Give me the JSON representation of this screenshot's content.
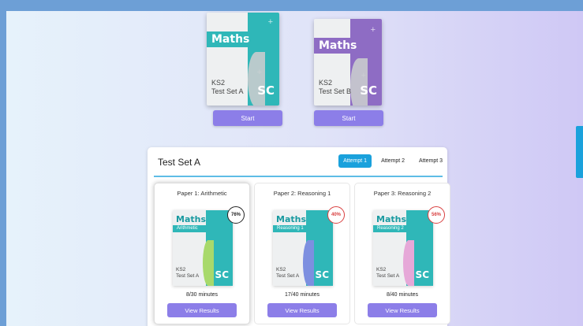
{
  "test_sets": [
    {
      "subject": "Maths",
      "level": "KS2",
      "name": "Test Set A",
      "logo": "SC",
      "start_label": "Start",
      "colors": {
        "band": "#2fb7b8",
        "stripe": "#2fb7b8"
      }
    },
    {
      "subject": "Maths",
      "level": "KS2",
      "name": "Test Set B",
      "logo": "SC",
      "start_label": "Start",
      "colors": {
        "band": "#8e6cc4",
        "stripe": "#8e6cc4"
      }
    }
  ],
  "results": {
    "title": "Test Set A",
    "tabs": [
      {
        "label": "Attempt 1",
        "active": true
      },
      {
        "label": "Attempt 2",
        "active": false
      },
      {
        "label": "Attempt 3",
        "active": false
      }
    ],
    "papers": [
      {
        "title": "Paper 1: Arithmetic",
        "subject": "Maths",
        "topic": "Arithmetic",
        "level": "KS2",
        "set": "Test Set A",
        "logo": "SC",
        "score": "76%",
        "duration": "8/30 minutes",
        "button": "View Results",
        "score_color": "#222222",
        "curve_color": "#a8d96b",
        "selected": true
      },
      {
        "title": "Paper 2: Reasoning 1",
        "subject": "Maths",
        "topic": "Reasoning 1",
        "level": "KS2",
        "set": "Test Set A",
        "logo": "SC",
        "score": "40%",
        "duration": "17/40 minutes",
        "button": "View Results",
        "score_color": "#d94040",
        "curve_color": "#7d8fe0",
        "selected": false
      },
      {
        "title": "Paper 3: Reasoning 2",
        "subject": "Maths",
        "topic": "Reasoning 2",
        "level": "KS2",
        "set": "Test Set A",
        "logo": "SC",
        "score": "56%",
        "duration": "8/40 minutes",
        "button": "View Results",
        "score_color": "#d94040",
        "curve_color": "#e6a8d8",
        "selected": false
      }
    ]
  }
}
